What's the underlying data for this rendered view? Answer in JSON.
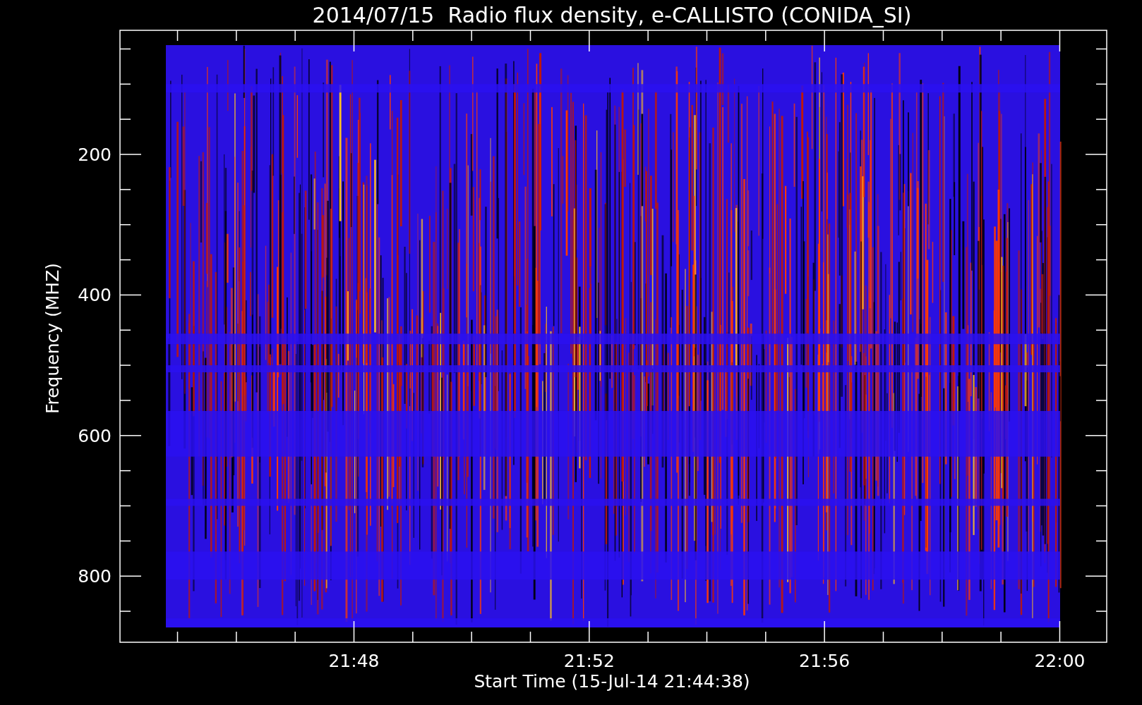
{
  "title": "2014/07/15  Radio flux density, e-CALLISTO (CONIDA_SI)",
  "y_axis": {
    "label": "Frequency (MHZ)",
    "tick_labels": [
      "200",
      "400",
      "600",
      "800"
    ]
  },
  "x_axis": {
    "label": "Start Time (15-Jul-14 21:44:38)",
    "tick_labels": [
      "21:48",
      "21:52",
      "21:56",
      "22:00"
    ]
  }
}
